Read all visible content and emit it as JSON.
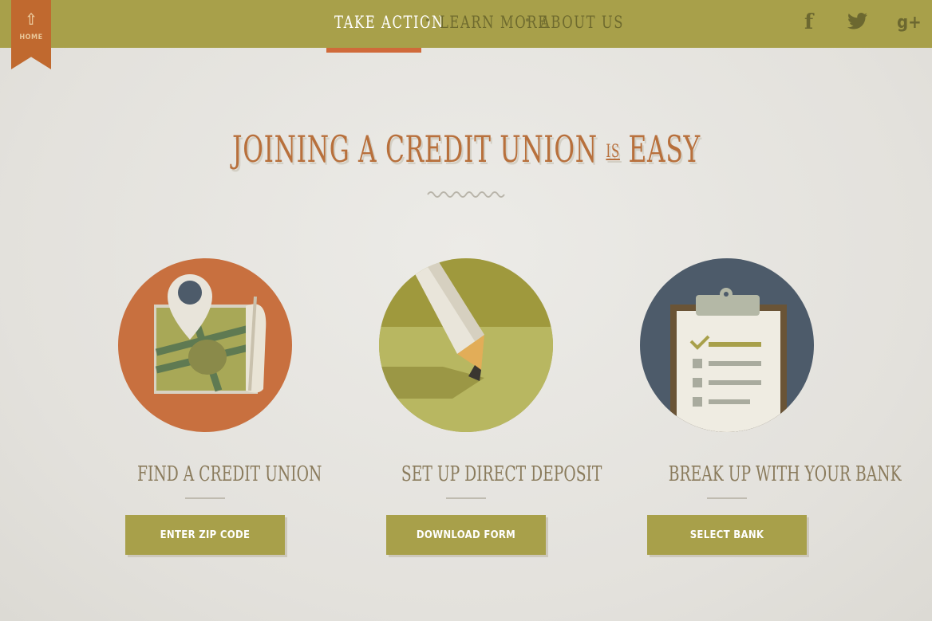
{
  "home": {
    "label": "HOME",
    "icon": "up-arrow-icon"
  },
  "nav": {
    "items": [
      {
        "label": "TAKE ACTION",
        "active": true
      },
      {
        "label": "LEARN MORE",
        "active": false
      },
      {
        "label": "ABOUT US",
        "active": false
      }
    ]
  },
  "social": {
    "facebook": "f",
    "twitter": "twitter-bird",
    "googleplus": "g+"
  },
  "headline": {
    "part1": "JOINING A CREDIT UNION",
    "is": "IS",
    "part2": "EASY"
  },
  "steps": [
    {
      "title": "FIND A CREDIT UNION",
      "button": "ENTER ZIP CODE",
      "icon": "map-pin-icon"
    },
    {
      "title": "SET UP DIRECT DEPOSIT",
      "button": "DOWNLOAD FORM",
      "icon": "pencil-icon"
    },
    {
      "title": "BREAK UP WITH YOUR BANK",
      "button": "SELECT BANK",
      "icon": "clipboard-icon"
    }
  ],
  "colors": {
    "olive": "#a8a04a",
    "orange": "#c0692f",
    "accent_underline": "#d06a3a",
    "slate": "#4d5b6a",
    "headline": "#b8703c"
  }
}
